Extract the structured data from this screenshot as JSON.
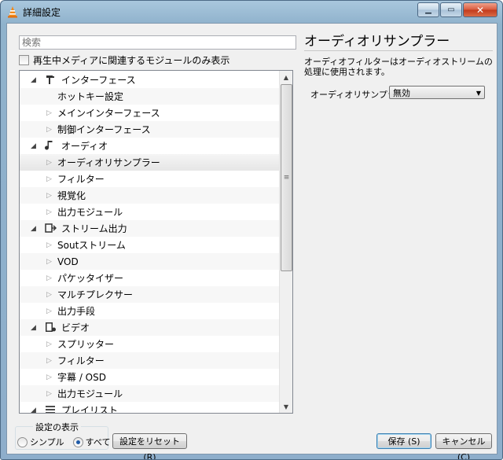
{
  "window": {
    "title": "詳細設定",
    "controls": [
      "minimize-icon",
      "maximize-icon",
      "close-icon"
    ]
  },
  "search": {
    "placeholder": "検索"
  },
  "filter": {
    "label": "再生中メディアに関連するモジュールのみ表示",
    "checked": false
  },
  "tree": [
    {
      "label": "インターフェース",
      "level": 0,
      "expanded": true,
      "icon": "interface-icon"
    },
    {
      "label": "ホットキー設定",
      "level": 1,
      "children": false
    },
    {
      "label": "メインインターフェース",
      "level": 1,
      "children": true
    },
    {
      "label": "制御インターフェース",
      "level": 1,
      "children": true
    },
    {
      "label": "オーディオ",
      "level": 0,
      "expanded": true,
      "icon": "audio-icon"
    },
    {
      "label": "オーディオリサンプラー",
      "level": 1,
      "children": true,
      "selected": true
    },
    {
      "label": "フィルター",
      "level": 1,
      "children": true
    },
    {
      "label": "視覚化",
      "level": 1,
      "children": true
    },
    {
      "label": "出力モジュール",
      "level": 1,
      "children": true
    },
    {
      "label": "ストリーム出力",
      "level": 0,
      "expanded": true,
      "icon": "stream-output-icon"
    },
    {
      "label": "Soutストリーム",
      "level": 1,
      "children": true
    },
    {
      "label": "VOD",
      "level": 1,
      "children": true
    },
    {
      "label": "パケッタイザー",
      "level": 1,
      "children": true
    },
    {
      "label": "マルチプレクサー",
      "level": 1,
      "children": true
    },
    {
      "label": "出力手段",
      "level": 1,
      "children": true
    },
    {
      "label": "ビデオ",
      "level": 0,
      "expanded": true,
      "icon": "video-icon"
    },
    {
      "label": "スプリッター",
      "level": 1,
      "children": true
    },
    {
      "label": "フィルター",
      "level": 1,
      "children": true
    },
    {
      "label": "字幕 / OSD",
      "level": 1,
      "children": true
    },
    {
      "label": "出力モジュール",
      "level": 1,
      "children": true
    },
    {
      "label": "プレイリスト",
      "level": 0,
      "expanded": true,
      "icon": "playlist-icon"
    }
  ],
  "panel": {
    "title": "オーディオリサンプラー",
    "description": "オーディオフィルターはオーディオストリームの処理に使用されます。",
    "field_label": "オーディオリサンプラー",
    "field_value": "無効"
  },
  "view": {
    "group_title": "設定の表示",
    "simple_label": "シンプル",
    "all_label": "すべて",
    "selected": "all"
  },
  "buttons": {
    "reset": "設定をリセット (R)",
    "save": "保存 (S)",
    "cancel": "キャンセル (C)"
  }
}
